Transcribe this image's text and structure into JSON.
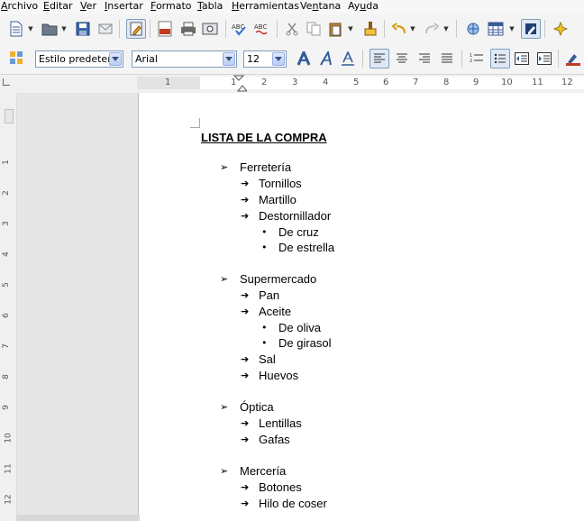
{
  "menu": [
    "Archivo",
    "Editar",
    "Ver",
    "Insertar",
    "Formato",
    "Tabla",
    "Herramientas",
    "Ventana",
    "Ayuda"
  ],
  "menu_accel": [
    "A",
    "E",
    "V",
    "I",
    "F",
    "T",
    "H",
    "n",
    "u"
  ],
  "format_bar": {
    "style_value": "Estilo predeterm",
    "font_value": "Arial",
    "size_value": "12"
  },
  "ruler_numbers": [
    "1",
    "1",
    "2",
    "3",
    "4",
    "5",
    "6",
    "7",
    "8",
    "9",
    "10",
    "11",
    "12"
  ],
  "vruler_numbers": [
    "1",
    "2",
    "3",
    "4",
    "5",
    "6",
    "7",
    "8",
    "9",
    "10",
    "11",
    "12"
  ],
  "document": {
    "title": "LISTA DE LA COMPRA",
    "sections": [
      {
        "name": "Ferretería",
        "items": [
          {
            "label": "Tornillos"
          },
          {
            "label": "Martillo"
          },
          {
            "label": "Destornillador",
            "sub": [
              "De cruz",
              "De estrella"
            ]
          }
        ]
      },
      {
        "name": "Supermercado",
        "items": [
          {
            "label": "Pan"
          },
          {
            "label": "Aceite",
            "sub": [
              "De oliva",
              "De girasol"
            ]
          },
          {
            "label": "Sal"
          },
          {
            "label": "Huevos"
          }
        ]
      },
      {
        "name": "Óptica",
        "items": [
          {
            "label": "Lentillas"
          },
          {
            "label": "Gafas"
          }
        ]
      },
      {
        "name": "Mercería",
        "items": [
          {
            "label": "Botones"
          },
          {
            "label": "Hilo de coser"
          }
        ]
      }
    ]
  },
  "bullets": {
    "level1": "➢",
    "level2": "➔",
    "level3": "•"
  }
}
